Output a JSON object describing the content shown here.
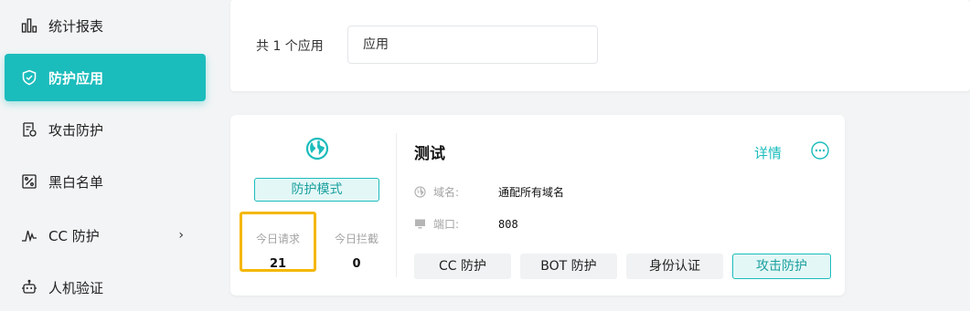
{
  "sidebar": {
    "items": [
      {
        "label": "统计报表",
        "icon": "bar-chart-icon",
        "active": false
      },
      {
        "label": "防护应用",
        "icon": "shield-icon",
        "active": true
      },
      {
        "label": "攻击防护",
        "icon": "document-check-icon",
        "active": false
      },
      {
        "label": "黑白名单",
        "icon": "percent-list-icon",
        "active": false
      },
      {
        "label": "CC 防护",
        "icon": "pulse-icon",
        "active": false,
        "chevron": "›"
      },
      {
        "label": "人机验证",
        "icon": "robot-icon",
        "active": false
      }
    ]
  },
  "filter": {
    "count_text": "共 1 个应用",
    "search_placeholder": "应用"
  },
  "app_card": {
    "name": "测试",
    "icon": "globe-icon",
    "mode_label": "防护模式",
    "stats": {
      "requests_label": "今日请求",
      "requests_value": "21",
      "blocked_label": "今日拦截",
      "blocked_value": "0"
    },
    "detail_label": "详情",
    "more_icon": "more-icon",
    "domain_label": "域名:",
    "domain_value": "通配所有域名",
    "port_label": "端口:",
    "port_value": "808",
    "features": [
      {
        "label": "CC 防护",
        "enabled": false
      },
      {
        "label": "BOT 防护",
        "enabled": false
      },
      {
        "label": "身份认证",
        "enabled": false
      },
      {
        "label": "攻击防护",
        "enabled": true
      }
    ]
  },
  "colors": {
    "accent": "#1bbcbc",
    "highlight": "#f5b700",
    "background": "#f2f4f5"
  }
}
